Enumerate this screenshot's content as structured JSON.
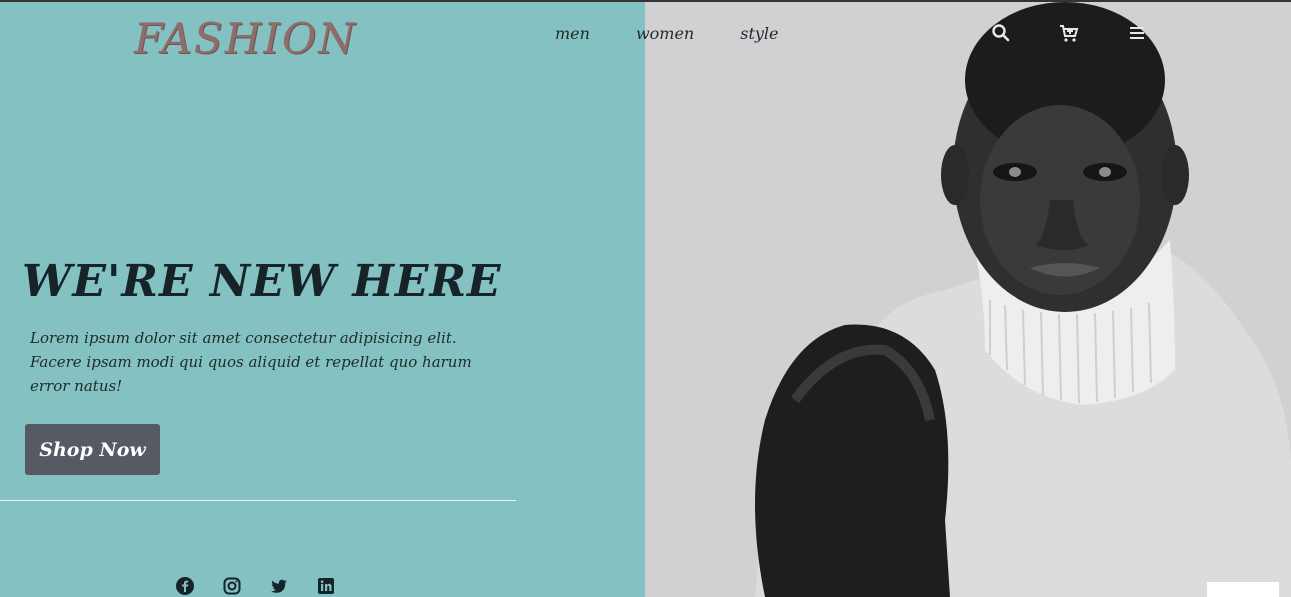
{
  "brand": {
    "logo": "FASHION"
  },
  "nav": {
    "links": [
      {
        "label": "men"
      },
      {
        "label": "women"
      },
      {
        "label": "style"
      }
    ],
    "icons": [
      "search-icon",
      "cart-icon",
      "menu-icon"
    ]
  },
  "hero": {
    "title": "WE'RE NEW HERE",
    "text": "Lorem ipsum dolor sit amet consectetur adipisicing elit. Facere ipsam modi qui quos aliquid et repellat quo harum error natus!",
    "button_label": "Shop Now"
  },
  "social": [
    "facebook-icon",
    "instagram-icon",
    "twitter-icon",
    "linkedin-icon"
  ],
  "colors": {
    "left_bg": "#84c1c2",
    "right_bg": "#d1d1d3",
    "button_bg": "#555a63",
    "logo": "#8e6d6a"
  }
}
